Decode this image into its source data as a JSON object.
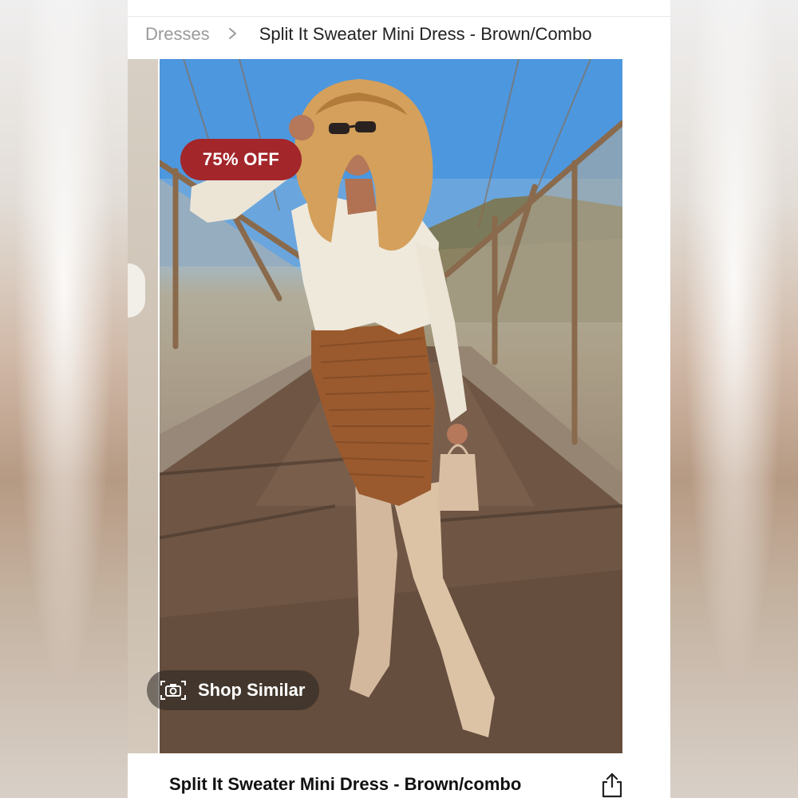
{
  "breadcrumb": {
    "parent": "Dresses",
    "current": "Split It Sweater Mini Dress - Brown/Combo"
  },
  "product": {
    "discount_badge": "75% OFF",
    "title": "Split It Sweater Mini Dress - Brown/combo"
  },
  "actions": {
    "shop_similar": "Shop Similar"
  },
  "icons": {
    "breadcrumb_separator": "chevron-right-icon",
    "shop_similar": "camera-icon",
    "share": "share-icon"
  },
  "colors": {
    "badge": "#a3262a",
    "title_text": "#111111"
  }
}
